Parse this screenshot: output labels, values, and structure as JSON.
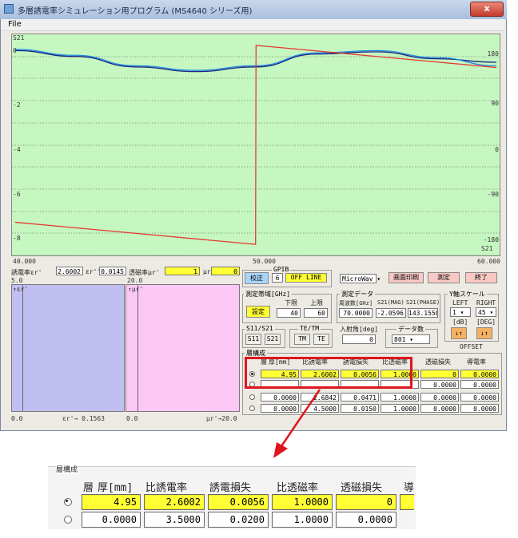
{
  "window": {
    "title": "多層誘電率シミュレーション用プログラム (MS4640 シリーズ用)",
    "close_label": "x"
  },
  "menu": {
    "file": "File"
  },
  "chart": {
    "title": "S21",
    "right_unit": "S21",
    "left_ticks": [
      "0",
      "-2",
      "-4",
      "-6",
      "-8"
    ],
    "right_ticks": [
      "180",
      "90",
      "0",
      "-90",
      "-180"
    ],
    "x_ticks": [
      "40.000",
      "50.000",
      "60.000"
    ],
    "colors": {
      "background": "#c6f7c0",
      "mag_line": "#1a237e",
      "mag_line2": "#1e88e5",
      "phase_line": "#e53935"
    }
  },
  "chart_data": {
    "type": "line",
    "title": "S21",
    "xlim": [
      40,
      60
    ],
    "ylim_left": [
      -9,
      0.5
    ],
    "ylim_right": [
      -200,
      200
    ],
    "series": [
      {
        "axis": "left",
        "x": [
          40,
          42.5,
          45,
          47.5,
          50,
          52.5,
          55,
          57.5,
          60
        ],
        "values": [
          -0.2,
          -0.45,
          -0.9,
          -1.1,
          -0.9,
          -0.35,
          -0.25,
          -0.55,
          -0.7
        ]
      },
      {
        "axis": "left",
        "x": [
          40,
          42.5,
          45,
          47.5,
          50,
          52.5,
          55,
          57.5,
          60
        ],
        "values": [
          -0.15,
          -0.4,
          -0.85,
          -1.05,
          -0.85,
          -0.3,
          -0.2,
          -0.5,
          -0.85
        ]
      },
      {
        "axis": "right",
        "x": [
          40,
          49.99,
          50.01,
          60
        ],
        "values": [
          -140,
          -180,
          180,
          140
        ]
      }
    ]
  },
  "controls": {
    "eps_label": "誘電率εr'",
    "eps_value": "2.6002",
    "eps2_label": "εr''",
    "eps2_value": "0.0145",
    "mu_label": "透磁率μr'",
    "mu_value": "1",
    "mu2_label": "μr''",
    "mu2_value": "0",
    "gpib_title": "GPIB",
    "calibrate": "校正",
    "gpib_addr": "6",
    "offline": "OFF LINE",
    "device": "MicroWav",
    "print": "画面印刷",
    "measure": "測定",
    "exit": "終了"
  },
  "panels": {
    "blue_top": "5.0",
    "blue_label": "↑εr'",
    "blue_bottom": "0.0",
    "blue_axis": "εr'→ 0.1563",
    "pink_top": "20.0",
    "pink_label": "↑μr'",
    "pink_bottom": "0.0",
    "pink_axis": "μr'→20.0"
  },
  "band": {
    "title": "測定帯域[GHz]",
    "lower_label": "下限",
    "upper_label": "上限",
    "set": "設定",
    "lower": "40",
    "upper": "60"
  },
  "mdata": {
    "title": "測定データ",
    "freq_label": "周波数[GHz]",
    "mag_label": "S21(MAG)",
    "phase_label": "S21(PHASE)",
    "freq": "70.0000",
    "mag": "-2.0596",
    "phase": "143.1550"
  },
  "yscale": {
    "title": "Y軸スケール",
    "left": "LEFT",
    "right": "RIGHT",
    "left_val": "1",
    "right_val": "45",
    "db": "[dB]",
    "deg": "[DEG]",
    "offset": "OFFSET"
  },
  "sparam": {
    "title": "S11/S21",
    "s11": "S11",
    "s21": "S21"
  },
  "tetm": {
    "title": "TE/TM",
    "tm": "TM",
    "te": "TE"
  },
  "incidence": {
    "title": "入射角[deg]",
    "value": "0"
  },
  "count": {
    "title": "データ数",
    "value": "801"
  },
  "layers": {
    "title": "層構成",
    "headers": [
      "層",
      "厚[mm]",
      "比誘電率",
      "誘電損失",
      "比透磁率",
      "透磁損失",
      "導電率"
    ],
    "rows": [
      {
        "thickness": "4.95",
        "eps": "2.6002",
        "loss": "0.0056",
        "mu": "1.0000",
        "mloss": "0",
        "cond": "0.0000"
      },
      {
        "thickness": "",
        "eps": "",
        "loss": "",
        "mu": "",
        "mloss": "0.0000",
        "cond": "0.0000"
      },
      {
        "thickness": "0.0000",
        "eps": "2.6842",
        "loss": "0.0471",
        "mu": "1.0000",
        "mloss": "0.0000",
        "cond": "0.0000"
      },
      {
        "thickness": "0.0000",
        "eps": "4.5000",
        "loss": "0.0150",
        "mu": "1.0000",
        "mloss": "0.0000",
        "cond": "0.0000"
      }
    ]
  },
  "zoom": {
    "title": "層構成",
    "headers": [
      "層",
      "厚[mm]",
      "比誘電率",
      "誘電損失",
      "比透磁率",
      "透磁損失",
      "導"
    ],
    "rows": [
      {
        "thickness": "4.95",
        "eps": "2.6002",
        "loss": "0.0056",
        "mu": "1.0000",
        "mloss": "0"
      },
      {
        "thickness": "0.0000",
        "eps": "3.5000",
        "loss": "0.0200",
        "mu": "1.0000",
        "mloss": "0.0000"
      }
    ]
  }
}
